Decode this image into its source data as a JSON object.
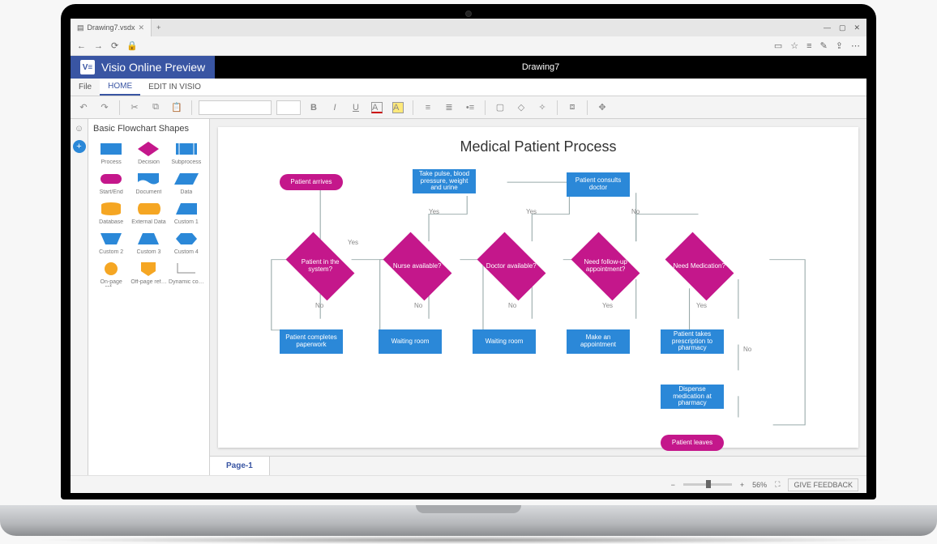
{
  "browser": {
    "tab_title": "Drawing7.vsdx",
    "win_min": "—",
    "win_max": "▢",
    "win_close": "✕"
  },
  "app": {
    "brand": "Visio Online Preview",
    "doc_title": "Drawing7"
  },
  "menu": {
    "file": "File",
    "home": "Home",
    "edit_in": "EDIT IN VISIO"
  },
  "shapes_panel": {
    "title": "Basic Flowchart Shapes",
    "items": [
      {
        "label": "Process"
      },
      {
        "label": "Decision"
      },
      {
        "label": "Subprocess"
      },
      {
        "label": "Start/End"
      },
      {
        "label": "Document"
      },
      {
        "label": "Data"
      },
      {
        "label": "Database"
      },
      {
        "label": "External Data"
      },
      {
        "label": "Custom 1"
      },
      {
        "label": "Custom 2"
      },
      {
        "label": "Custom 3"
      },
      {
        "label": "Custom 4"
      },
      {
        "label": "On-page ref…"
      },
      {
        "label": "Off-page ref…"
      },
      {
        "label": "Dynamic co…"
      }
    ]
  },
  "diagram": {
    "title": "Medical Patient Process",
    "nodes": {
      "start": "Patient arrives",
      "vitals": "Take pulse, blood pressure, weight and urine",
      "consult": "Patient consults doctor",
      "d_in_system": "Patient in the system?",
      "d_nurse": "Nurse available?",
      "d_doctor": "Doctor available?",
      "d_followup": "Need follow-up appointment?",
      "d_med": "Need Medication?",
      "paperwork": "Patient completes paperwork",
      "wait1": "Waiting room",
      "wait2": "Waiting room",
      "appt": "Make an appointment",
      "rx": "Patient takes prescription to pharmacy",
      "dispense": "Dispense medication at pharmacy",
      "end": "Patient leaves"
    },
    "labels": {
      "yes": "Yes",
      "no": "No"
    }
  },
  "page_tab": "Page-1",
  "status": {
    "zoom_minus": "−",
    "zoom_plus": "+",
    "zoom_pct": "56%",
    "feedback": "GIVE FEEDBACK"
  },
  "colors": {
    "brand": "#3955a3",
    "pink": "#c4178b",
    "blue": "#2b88d8"
  }
}
